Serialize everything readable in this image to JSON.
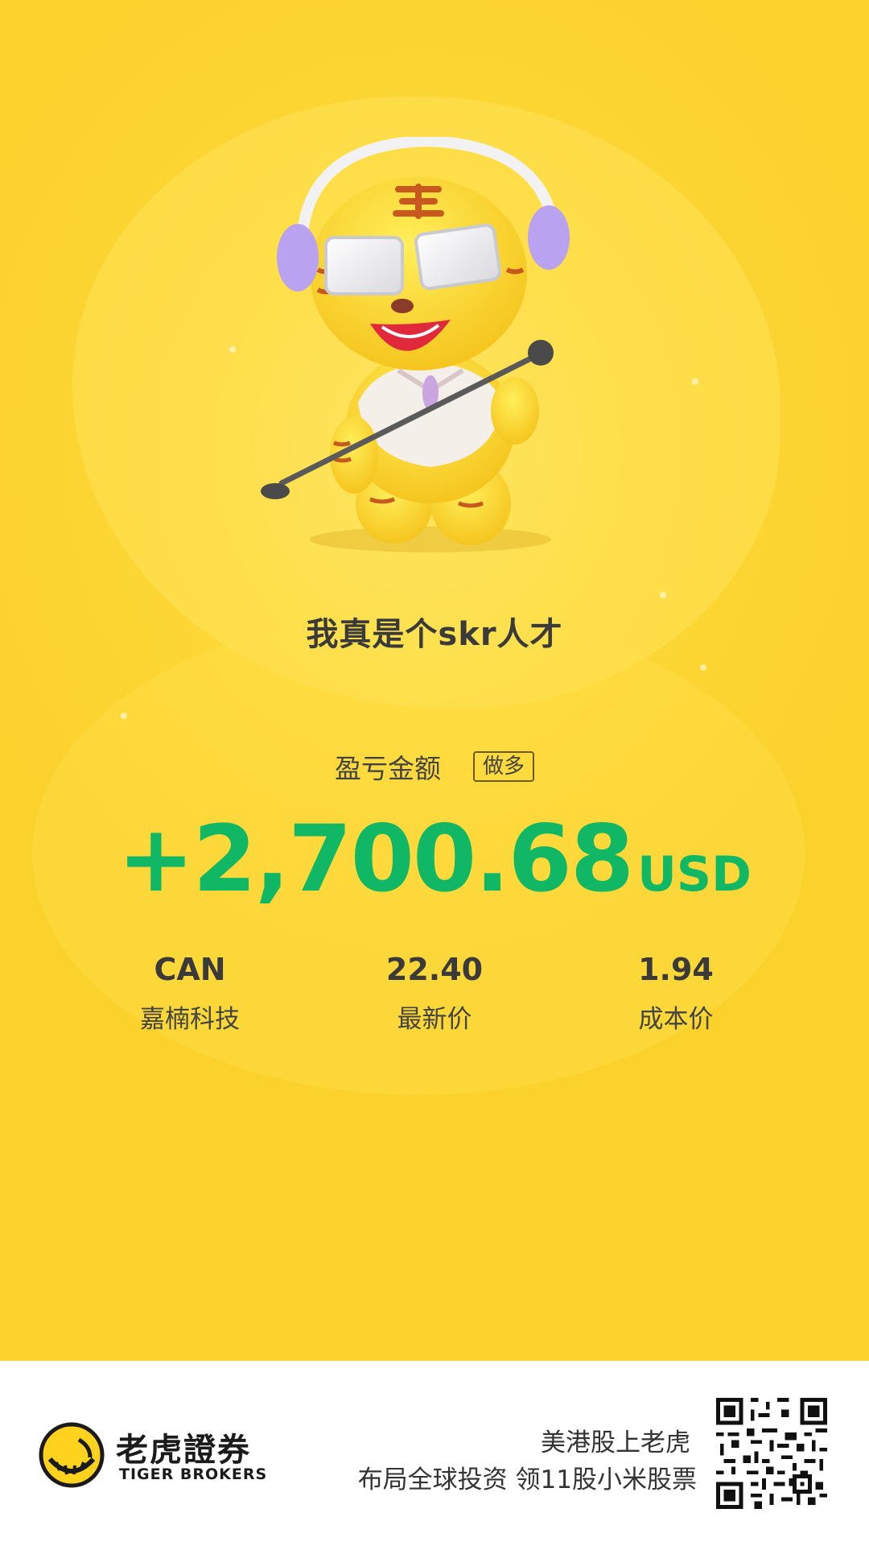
{
  "headline": "我真是个skr人才",
  "pnl": {
    "label": "盈亏金额",
    "direction_badge": "做多",
    "amount": "+2,700.68",
    "currency": "USD",
    "color": "#10b765"
  },
  "stats": [
    {
      "value": "CAN",
      "label": "嘉楠科技"
    },
    {
      "value": "22.40",
      "label": "最新价"
    },
    {
      "value": "1.94",
      "label": "成本价"
    }
  ],
  "footer": {
    "brand_cn": "老虎證券",
    "brand_en": "TIGER BROKERS",
    "slogan_line1": "美港股上老虎",
    "slogan_line2": "布局全球投资 领11股小米股票",
    "qr_icon": "qr-code-icon",
    "logo_icon": "tiger-brokers-logo-icon"
  },
  "colors": {
    "background": "#fbd12c",
    "accent": "#10b765"
  }
}
